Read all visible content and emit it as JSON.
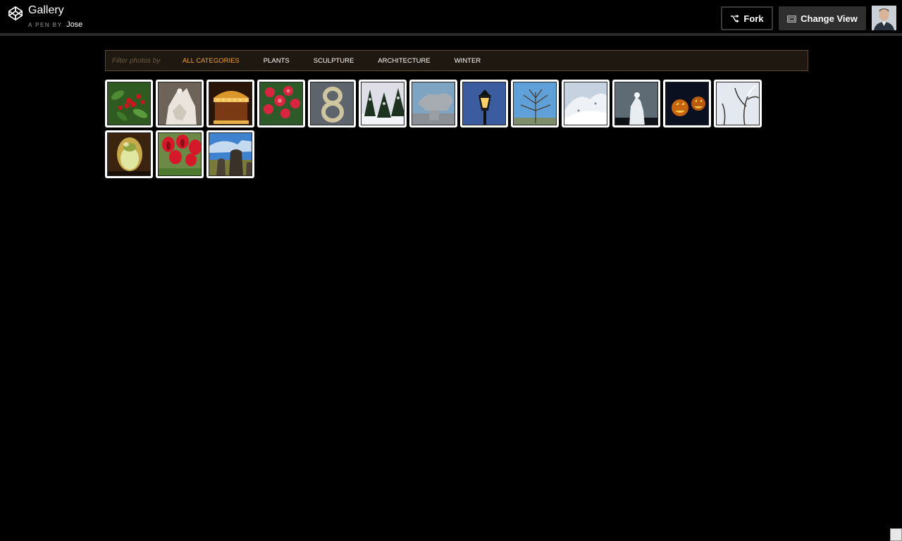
{
  "header": {
    "title": "Gallery",
    "byline_prefix": "A PEN BY",
    "author": "Jose",
    "fork_label": "Fork",
    "change_view_label": "Change View"
  },
  "filter": {
    "label": "Filter photos by",
    "categories": [
      "ALL CATEGORIES",
      "PLANTS",
      "SCULPTURE",
      "ARCHITECTURE",
      "WINTER"
    ],
    "active": "ALL CATEGORIES"
  },
  "photos": [
    {
      "subject": "holly-berries"
    },
    {
      "subject": "white-sculpture"
    },
    {
      "subject": "carousel"
    },
    {
      "subject": "red-flowers"
    },
    {
      "subject": "number-eight"
    },
    {
      "subject": "snowy-trees"
    },
    {
      "subject": "stone-sculpture"
    },
    {
      "subject": "street-lamp"
    },
    {
      "subject": "bare-tree-blue-sky"
    },
    {
      "subject": "snowy-slope"
    },
    {
      "subject": "snowy-statue"
    },
    {
      "subject": "jack-o-lanterns"
    },
    {
      "subject": "snowy-branches"
    },
    {
      "subject": "glass-paperweight"
    },
    {
      "subject": "red-tulips"
    },
    {
      "subject": "easter-island-moai"
    }
  ],
  "colors": {
    "accent": "#f0a030",
    "filter_bg": "#1f1810",
    "filter_border": "#5a4632"
  }
}
